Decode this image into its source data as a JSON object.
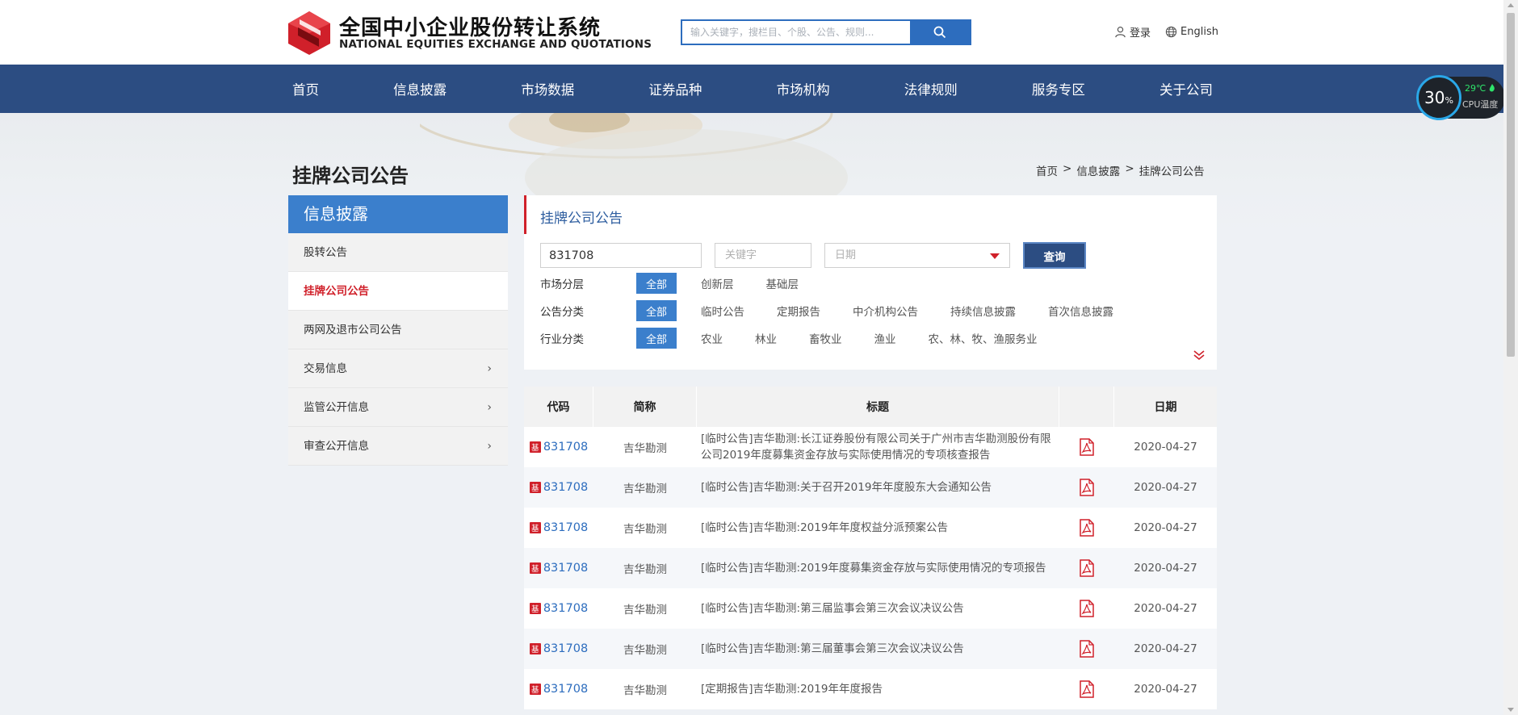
{
  "header": {
    "logo_cn": "全国中小企业股份转让系统",
    "logo_en": "NATIONAL EQUITIES EXCHANGE AND QUOTATIONS",
    "search_placeholder": "输入关键字，搜栏目、个股、公告、规则...",
    "login_label": "登录",
    "language_label": "English"
  },
  "nav": {
    "items": [
      "首页",
      "信息披露",
      "市场数据",
      "证券品种",
      "市场机构",
      "法律规则",
      "服务专区",
      "关于公司"
    ]
  },
  "page": {
    "title": "挂牌公司公告",
    "breadcrumb": [
      "首页",
      ">",
      "信息披露",
      ">",
      "挂牌公司公告"
    ]
  },
  "sidebar": {
    "heading": "信息披露",
    "items": [
      {
        "label": "股转公告",
        "active": false,
        "has_arrow": false
      },
      {
        "label": "挂牌公司公告",
        "active": true,
        "has_arrow": false
      },
      {
        "label": "两网及退市公司公告",
        "active": false,
        "has_arrow": false
      },
      {
        "label": "交易信息",
        "active": false,
        "has_arrow": true
      },
      {
        "label": "监管公开信息",
        "active": false,
        "has_arrow": true
      },
      {
        "label": "审查公开信息",
        "active": false,
        "has_arrow": true
      }
    ],
    "arrow_glyph": "›"
  },
  "filters": {
    "title": "挂牌公司公告",
    "code_value": "831708",
    "keyword_placeholder": "关键字",
    "date_placeholder": "日期",
    "query_label": "查询",
    "market_tier": {
      "label": "市场分层",
      "all": "全部",
      "options": [
        "创新层",
        "基础层"
      ]
    },
    "announcement_type": {
      "label": "公告分类",
      "all": "全部",
      "options": [
        "临时公告",
        "定期报告",
        "中介机构公告",
        "持续信息披露",
        "首次信息披露"
      ]
    },
    "industry": {
      "label": "行业分类",
      "all": "全部",
      "options": [
        "农业",
        "林业",
        "畜牧业",
        "渔业",
        "农、林、牧、渔服务业"
      ]
    }
  },
  "table": {
    "headers": {
      "code": "代码",
      "name": "简称",
      "title": "标题",
      "pdf": "",
      "date": "日期"
    },
    "badge": "基",
    "rows": [
      {
        "code": "831708",
        "name": "吉华勘测",
        "title": "[临时公告]吉华勘测:长江证券股份有限公司关于广州市吉华勘测股份有限公司2019年度募集资金存放与实际使用情况的专项核查报告",
        "date": "2020-04-27"
      },
      {
        "code": "831708",
        "name": "吉华勘测",
        "title": "[临时公告]吉华勘测:关于召开2019年年度股东大会通知公告",
        "date": "2020-04-27"
      },
      {
        "code": "831708",
        "name": "吉华勘测",
        "title": "[临时公告]吉华勘测:2019年年度权益分派预案公告",
        "date": "2020-04-27"
      },
      {
        "code": "831708",
        "name": "吉华勘测",
        "title": "[临时公告]吉华勘测:2019年度募集资金存放与实际使用情况的专项报告",
        "date": "2020-04-27"
      },
      {
        "code": "831708",
        "name": "吉华勘测",
        "title": "[临时公告]吉华勘测:第三届监事会第三次会议决议公告",
        "date": "2020-04-27"
      },
      {
        "code": "831708",
        "name": "吉华勘测",
        "title": "[临时公告]吉华勘测:第三届董事会第三次会议决议公告",
        "date": "2020-04-27"
      },
      {
        "code": "831708",
        "name": "吉华勘测",
        "title": "[定期报告]吉华勘测:2019年年度报告",
        "date": "2020-04-27"
      }
    ]
  },
  "cpu_widget": {
    "percent": "30",
    "percent_unit": "%",
    "temperature": "29℃",
    "label": "CPU温度"
  },
  "colors": {
    "nav_bg": "#2c4d82",
    "accent_blue": "#3b7fcc",
    "accent_red": "#d0202a",
    "link_blue": "#2d6dbe"
  }
}
